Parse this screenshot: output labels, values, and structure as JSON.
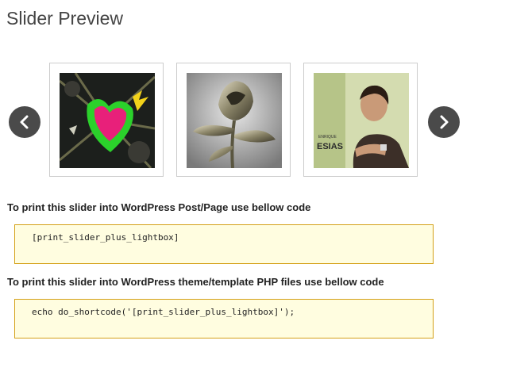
{
  "page": {
    "title": "Slider Preview"
  },
  "slider": {
    "prev_icon": "chevron-left-icon",
    "next_icon": "chevron-right-icon",
    "slides": [
      {
        "name": "heart-artwork"
      },
      {
        "name": "metal-rose"
      },
      {
        "name": "enrique-iglesias-album-cover",
        "caption_small": "ENRIQUE",
        "caption_large": "ESIAS"
      }
    ]
  },
  "code_sections": [
    {
      "heading": "To print this slider into WordPress Post/Page use bellow code",
      "code": "[print_slider_plus_lightbox]"
    },
    {
      "heading": "To print this slider into WordPress theme/template PHP files use bellow code",
      "code": "echo do_shortcode('[print_slider_plus_lightbox]');"
    }
  ],
  "colors": {
    "code_background": "#fffde0",
    "code_border": "#d4a017",
    "nav_button": "#4a4a4a"
  }
}
